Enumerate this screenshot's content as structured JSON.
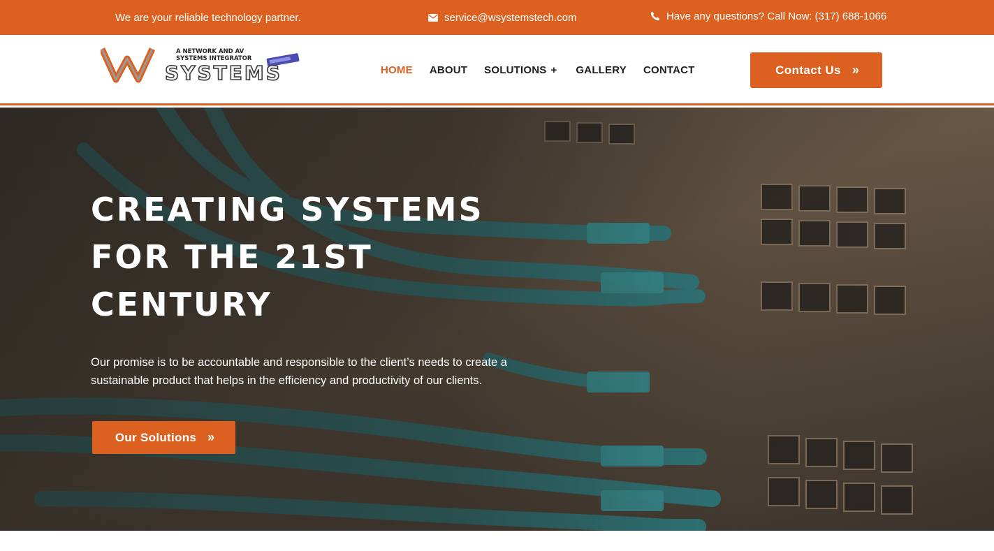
{
  "colors": {
    "accent": "#dc6121",
    "text_dark": "#1f1f1f",
    "white": "#ffffff"
  },
  "topbar": {
    "tagline": "We are your reliable technology partner.",
    "email": "service@wsystemstech.com",
    "email_icon": "envelope-icon",
    "phone_text": "Have any questions? Call Now: (317) 688-1066",
    "phone_icon": "phone-icon"
  },
  "logo": {
    "mark": "W",
    "wordmark": "SYSTEMS",
    "tagline_line1": "A NETWORK AND AV",
    "tagline_line2": "SYSTEMS INTEGRATOR"
  },
  "nav": {
    "items": [
      {
        "label": "HOME",
        "active": true
      },
      {
        "label": "ABOUT",
        "active": false
      },
      {
        "label": "SOLUTIONS",
        "active": false,
        "has_submenu": true,
        "submenu_icon": "plus-icon",
        "submenu_glyph": "+"
      },
      {
        "label": "GALLERY",
        "active": false
      },
      {
        "label": "CONTACT",
        "active": false
      }
    ]
  },
  "header": {
    "cta_label": "Contact Us",
    "cta_icon": "double-chevron-right-icon",
    "cta_glyph": "»"
  },
  "hero": {
    "title_lines": [
      "CREATING SYSTEMS",
      "FOR THE 21ST",
      "CENTURY"
    ],
    "text": "Our promise is to be accountable and responsible to the client’s needs to create a sustainable product that helps in the efficiency and productivity of our clients.",
    "cta_label": "Our Solutions",
    "cta_icon": "double-chevron-right-icon",
    "cta_glyph": "»",
    "background_icon": "network-cables-photo"
  }
}
